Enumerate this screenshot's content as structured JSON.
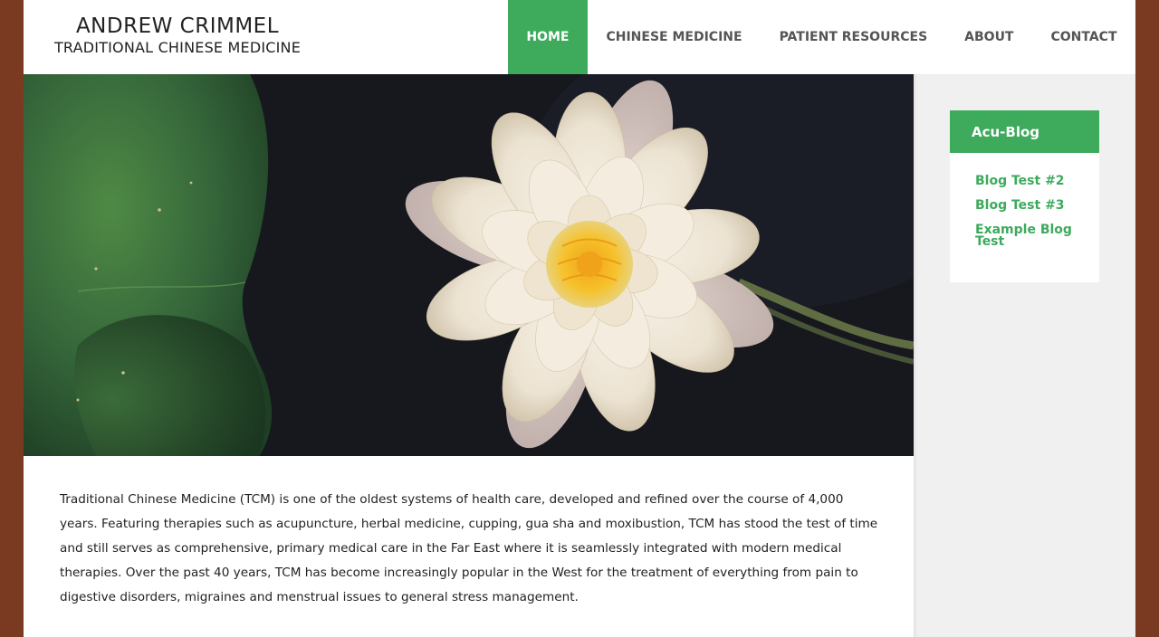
{
  "header": {
    "brand_name": "ANDREW CRIMMEL",
    "brand_sub": "TRADITIONAL CHINESE MEDICINE",
    "nav": [
      {
        "label": "HOME",
        "active": true
      },
      {
        "label": "CHINESE MEDICINE",
        "active": false
      },
      {
        "label": "PATIENT RESOURCES",
        "active": false
      },
      {
        "label": "ABOUT",
        "active": false
      },
      {
        "label": "CONTACT",
        "active": false
      }
    ]
  },
  "main": {
    "intro": "Traditional Chinese Medicine (TCM) is one of the oldest systems of health care, developed and refined over the course of 4,000 years. Featuring therapies such as acupuncture, herbal medicine, cupping, gua sha and moxibustion, TCM has stood the test of time and still serves as comprehensive, primary medical care in the Far East where it is seamlessly integrated with modern medical therapies. Over the past 40 years, TCM has become increasingly popular in the West for the treatment of everything from pain to digestive disorders, migraines and menstrual issues to general stress management."
  },
  "sidebar": {
    "widget_title": "Acu-Blog",
    "posts": [
      "Blog Test #2",
      "Blog Test #3",
      "Example Blog Test"
    ]
  },
  "colors": {
    "accent": "#3daa5c",
    "outer_background": "#7a3a22",
    "sidebar_background": "#f0f0f0"
  }
}
